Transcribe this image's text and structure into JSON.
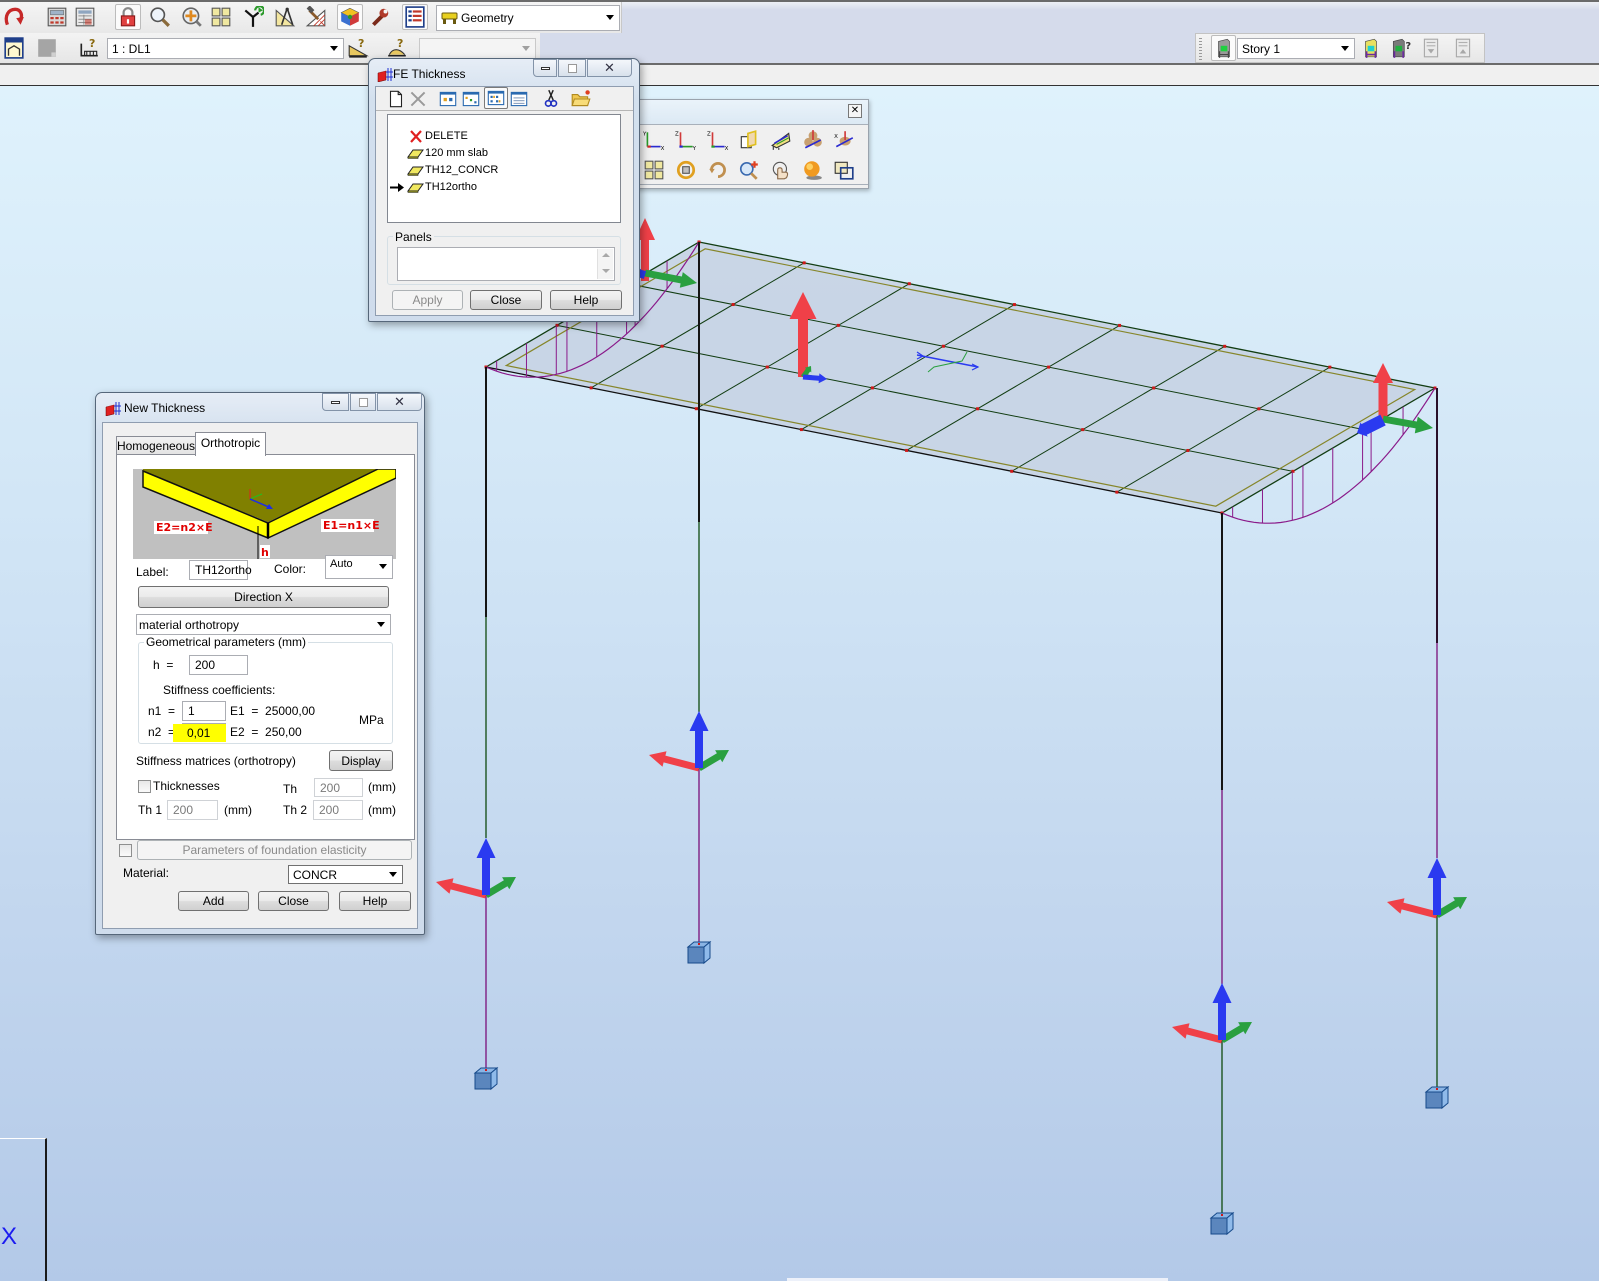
{
  "main_toolbar": {
    "icons": [
      "undo-icon",
      "calculator-icon",
      "calculation-table-icon",
      "lock-icon",
      "zoom-icon",
      "zoom-pan-icon",
      "views-icon",
      "branch-icon",
      "geometry-tools-icon",
      "hatch-hammer-icon",
      "structure-icon",
      "wrench-icon",
      "tables-icon"
    ],
    "layout_combo": {
      "icon": "layout-icon",
      "value": "Geometry"
    }
  },
  "load_toolbar": {
    "icons": [
      "frame-icon",
      "disabled-square-icon",
      "load-definition-icon",
      "load-query-icon",
      "load-query-2-icon"
    ],
    "load_case_combo": "1 : DL1",
    "secondary_combo": ""
  },
  "story_toolbar": {
    "icons": [
      "story-icon",
      "story-up-icon",
      "story-query-icon",
      "story-down-icon",
      "story-top-icon"
    ],
    "story_combo": "Story 1"
  },
  "fe_thickness": {
    "title": "FE Thickness",
    "toolbar_icons": [
      "new-document-icon",
      "delete-icon",
      "large-icons-view-icon",
      "small-icons-view-icon",
      "list-view-icon",
      "details-view-icon",
      "cut-icon",
      "open-folder-icon"
    ],
    "items": [
      {
        "label": "DELETE",
        "icon": "delete-item-icon",
        "selected": false
      },
      {
        "label": "120 mm slab",
        "icon": "slab-icon",
        "selected": false
      },
      {
        "label": "TH12_CONCR",
        "icon": "slab-icon",
        "selected": false
      },
      {
        "label": "TH12ortho",
        "icon": "slab-icon",
        "selected": true
      }
    ],
    "panels_label": "Panels",
    "panels_value": "",
    "buttons": {
      "apply": "Apply",
      "close": "Close",
      "help": "Help"
    }
  },
  "view_toolbar": {
    "row1_icons": [
      "view-xy-icon",
      "view-zy-icon",
      "view-zx-icon",
      "section-cut-icon",
      "perspective-icon",
      "rotate-3d-icon",
      "rotate-axis-icon"
    ],
    "row2_icons": [
      "predefined-views-icon",
      "orbit-icon",
      "rotate-icon",
      "zoom-in-icon",
      "pan-icon",
      "render-icon",
      "overlap-icon"
    ]
  },
  "new_thickness": {
    "title": "New Thickness",
    "tabs": [
      {
        "label": "Homogeneous",
        "active": false
      },
      {
        "label": "Orthotropic",
        "active": true
      }
    ],
    "diagram": {
      "e2_label": "E2=n2×E",
      "e1_label": "E1=n1×E",
      "h_label": "h"
    },
    "label_caption": "Label:",
    "label_value": "TH12ortho",
    "color_caption": "Color:",
    "color_value": "Auto",
    "direction_button": "Direction X",
    "orthotropy_type": "material orthotropy",
    "geometry_group": "Geometrical parameters (mm)",
    "h_caption": "h  =",
    "h_value": "200",
    "stiffness_caption": "Stiffness coefficients:",
    "n1_caption": "n1  =",
    "n1_value": "1",
    "e1_text": "E1  =  25000,00",
    "n2_caption": "n2  =",
    "n2_value": "0,01",
    "e2_text": "E2  =  250,00",
    "unit": "MPa",
    "matrices_caption": "Stiffness matrices (orthotropy)",
    "display_button": "Display",
    "thicknesses_label": "Thicknesses",
    "thicknesses_checked": false,
    "th_caption": "Th",
    "th_value": "200",
    "th1_caption": "Th 1",
    "th1_value": "200",
    "th2_caption": "Th 2",
    "th2_value": "200",
    "mm_unit": "(mm)",
    "foundation_checked": false,
    "foundation_button": "Parameters of foundation elasticity",
    "material_caption": "Material:",
    "material_value": "CONCR",
    "buttons": {
      "add": "Add",
      "close": "Close",
      "help": "Help"
    }
  },
  "viewport": {
    "axis_label": "X"
  },
  "colors": {
    "highlight": "#ffff00",
    "viewport_top": "#dff2fc",
    "viewport_bottom": "#b3c9e8",
    "axis_label": "#1b1bf0"
  }
}
